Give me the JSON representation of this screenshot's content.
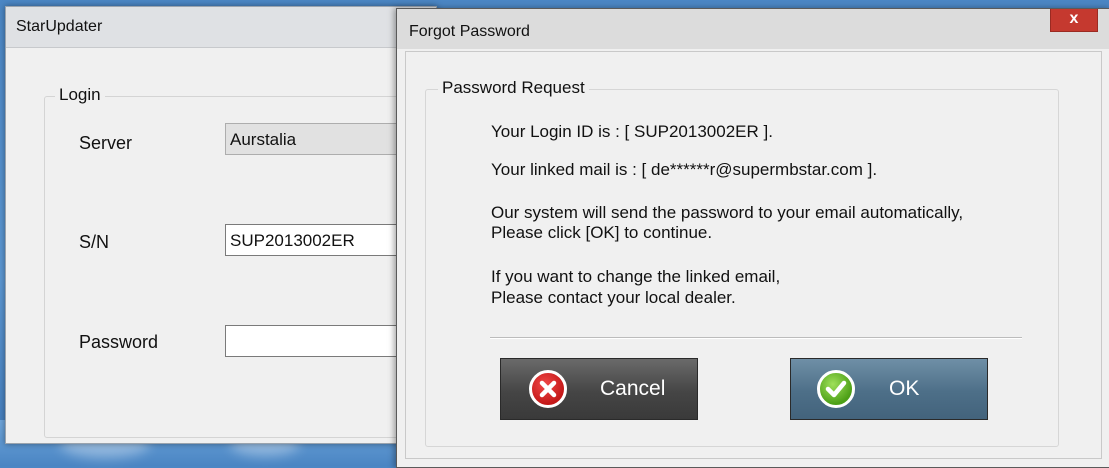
{
  "main_window": {
    "title": "StarUpdater",
    "login_group": {
      "legend": "Login",
      "server_label": "Server",
      "server_value": "Aurstalia",
      "sn_label": "S/N",
      "sn_value": "SUP2013002ER",
      "password_label": "Password",
      "password_value": ""
    }
  },
  "dialog": {
    "title": "Forgot Password",
    "close_label": "x",
    "group_legend": "Password Request",
    "login_id_line": "Your Login ID is : [ SUP2013002ER ].",
    "linked_mail_line": "Your linked mail is : [ de******r@supermbstar.com ].",
    "send_line_1": "Our system will send the password to your email automatically,",
    "send_line_2": "Please click [OK] to continue.",
    "change_line_1": "If you want to change the linked email,",
    "change_line_2": "Please contact your local dealer.",
    "cancel_label": "Cancel",
    "ok_label": "OK"
  },
  "icons": {
    "close": "close-icon",
    "cancel": "x-circle-icon",
    "ok": "check-circle-icon"
  },
  "colors": {
    "close_button": "#c5392f",
    "cancel_button": "#454545",
    "ok_button": "#4d6f88",
    "cancel_icon": "#d42020",
    "ok_icon": "#5fb021"
  }
}
